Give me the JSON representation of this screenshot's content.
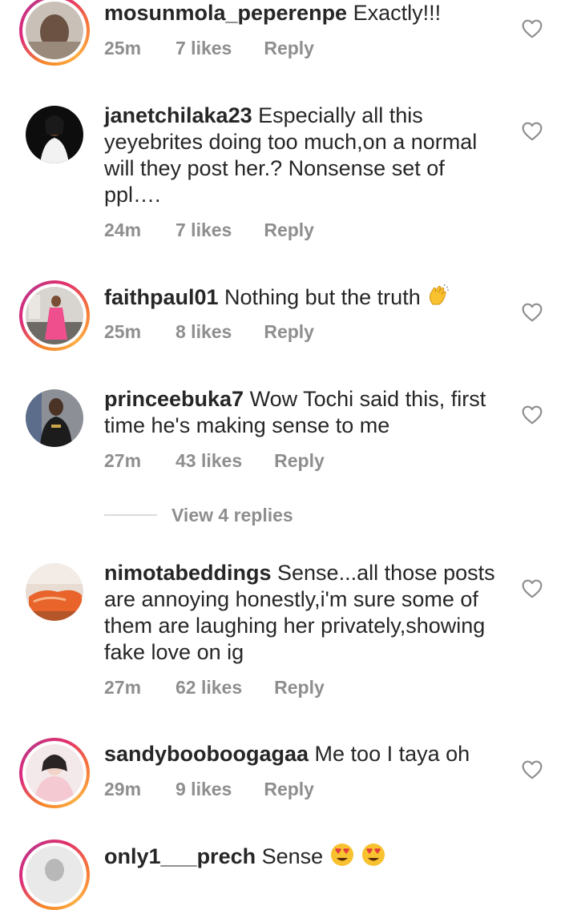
{
  "comments": [
    {
      "username": "mosunmola_peperenpe",
      "text": "Exactly!!!",
      "time": "25m",
      "likes": "7 likes",
      "reply": "Reply",
      "has_story_ring": true
    },
    {
      "username": "janetchilaka23",
      "text": "Especially all this yeyebrites doing too much,on a normal will they post her.? Nonsense set of ppl….",
      "time": "24m",
      "likes": "7 likes",
      "reply": "Reply",
      "has_story_ring": false
    },
    {
      "username": "faithpaul01",
      "text": "Nothing but the truth",
      "emoji": "clapping-hands",
      "time": "25m",
      "likes": "8 likes",
      "reply": "Reply",
      "has_story_ring": true
    },
    {
      "username": "princeebuka7",
      "text": "Wow Tochi said this, first time he's making sense to me",
      "time": "27m",
      "likes": "43 likes",
      "reply": "Reply",
      "has_story_ring": false,
      "view_replies": "View 4 replies"
    },
    {
      "username": "nimotabeddings",
      "text": "Sense...all those posts are annoying honestly,i'm sure some of them are laughing her privately,showing fake love on ig",
      "time": "27m",
      "likes": "62 likes",
      "reply": "Reply",
      "has_story_ring": false
    },
    {
      "username": "sandybooboogagaa",
      "text": "Me too I taya oh",
      "time": "29m",
      "likes": "9 likes",
      "reply": "Reply",
      "has_story_ring": true
    },
    {
      "username": "only1___prech",
      "text": "Sense",
      "emoji": "heart-eyes-x2",
      "has_story_ring": true
    }
  ],
  "icons": {
    "like": "heart-outline-icon",
    "clap": "clapping-hands-emoji",
    "heart_eyes": "heart-eyes-emoji"
  },
  "colors": {
    "text": "#262626",
    "meta": "#8e8e8e",
    "ring_start": "#f58529",
    "ring_end": "#dd2a7b"
  }
}
